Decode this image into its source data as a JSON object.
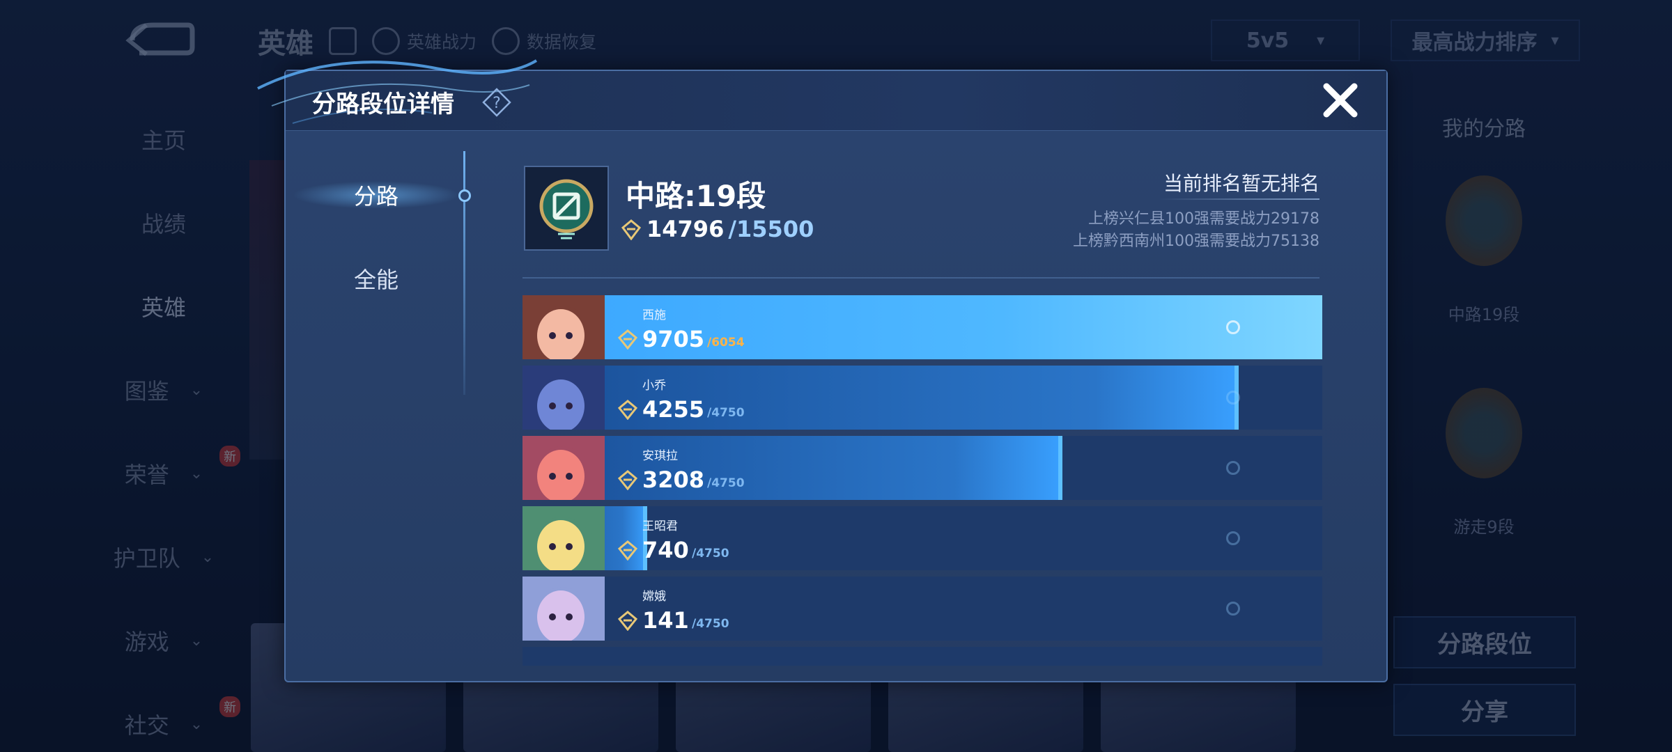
{
  "background": {
    "title": "英雄",
    "hero_power_label": "英雄战力",
    "data_restore_label": "数据恢复",
    "mode_select": "5v5",
    "sort_select": "最高战力排序",
    "nav": [
      {
        "label": "主页",
        "chevron": false,
        "badge": ""
      },
      {
        "label": "战绩",
        "chevron": false,
        "badge": ""
      },
      {
        "label": "英雄",
        "chevron": false,
        "badge": ""
      },
      {
        "label": "图鉴",
        "chevron": true,
        "badge": ""
      },
      {
        "label": "荣誉",
        "chevron": true,
        "badge": "新"
      },
      {
        "label": "护卫队",
        "chevron": true,
        "badge": ""
      },
      {
        "label": "游戏",
        "chevron": true,
        "badge": ""
      },
      {
        "label": "社交",
        "chevron": true,
        "badge": "新"
      }
    ],
    "right_panel": {
      "title": "我的分路",
      "lane1": "中路19段",
      "lane2": "游走9段",
      "lane_rank_button": "分路段位",
      "share_button": "分享"
    }
  },
  "modal": {
    "title": "分路段位详情",
    "tabs": [
      "分路",
      "全能"
    ],
    "rank_title": "中路:19段",
    "power_current": "14796",
    "power_max": "/15500",
    "rank_status": "当前排名暂无排名",
    "requirements": [
      "上榜兴仁县100强需要战力29178",
      "上榜黔西南州100强需要战力75138"
    ],
    "heroes": [
      {
        "name": "西施",
        "power": "9705",
        "max": "/6054",
        "progress": 1.0
      },
      {
        "name": "小乔",
        "power": "4255",
        "max": "/4750",
        "progress": 0.8958
      },
      {
        "name": "安琪拉",
        "power": "3208",
        "max": "/4750",
        "progress": 0.6754
      },
      {
        "name": "王昭君",
        "power": "740",
        "max": "/4750",
        "progress": 0.1558
      },
      {
        "name": "嫦娥",
        "power": "141",
        "max": "/4750",
        "progress": 0.0297
      }
    ]
  },
  "colors": {
    "accent": "#3aa6ff",
    "gold": "#e8c877",
    "overflow_max": "#ffb347"
  }
}
